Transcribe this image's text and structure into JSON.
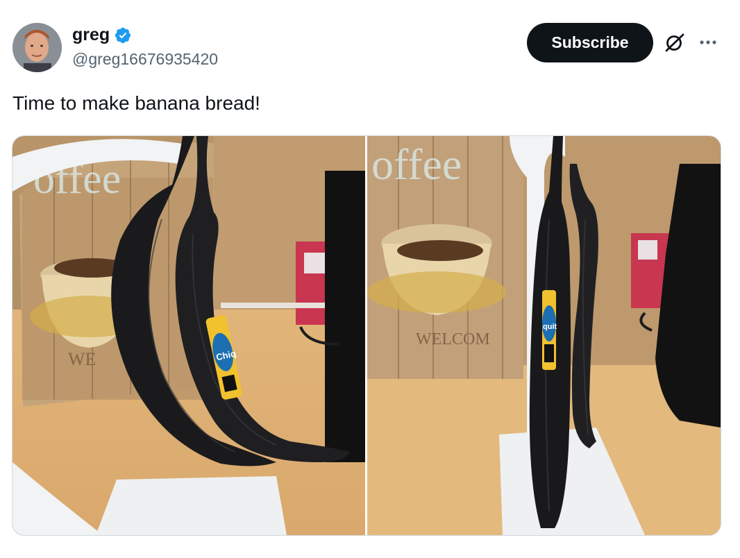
{
  "author": {
    "name": "greg",
    "handle": "@greg16676935420",
    "verified_icon": "verified-badge-icon"
  },
  "actions": {
    "subscribe_label": "Subscribe",
    "grok_icon": "grok-icon",
    "more_icon": "more-options-icon"
  },
  "tweet": {
    "text": "Time to make banana bread!"
  },
  "media": {
    "photos": [
      {
        "description_icon": "photo-bananas-left"
      },
      {
        "description_icon": "photo-bananas-right"
      }
    ]
  },
  "photo_signage": {
    "left_sign_top": "offee",
    "left_sign_bottom": "WE",
    "left_label": "Chiq",
    "right_sign_top": "offee",
    "right_sign_bottom": "WELCOM",
    "right_label": "quit"
  },
  "colors": {
    "brand_verified": "#1d9bf0",
    "subscribe_bg": "#0f1419",
    "handle_gray": "#536471"
  }
}
